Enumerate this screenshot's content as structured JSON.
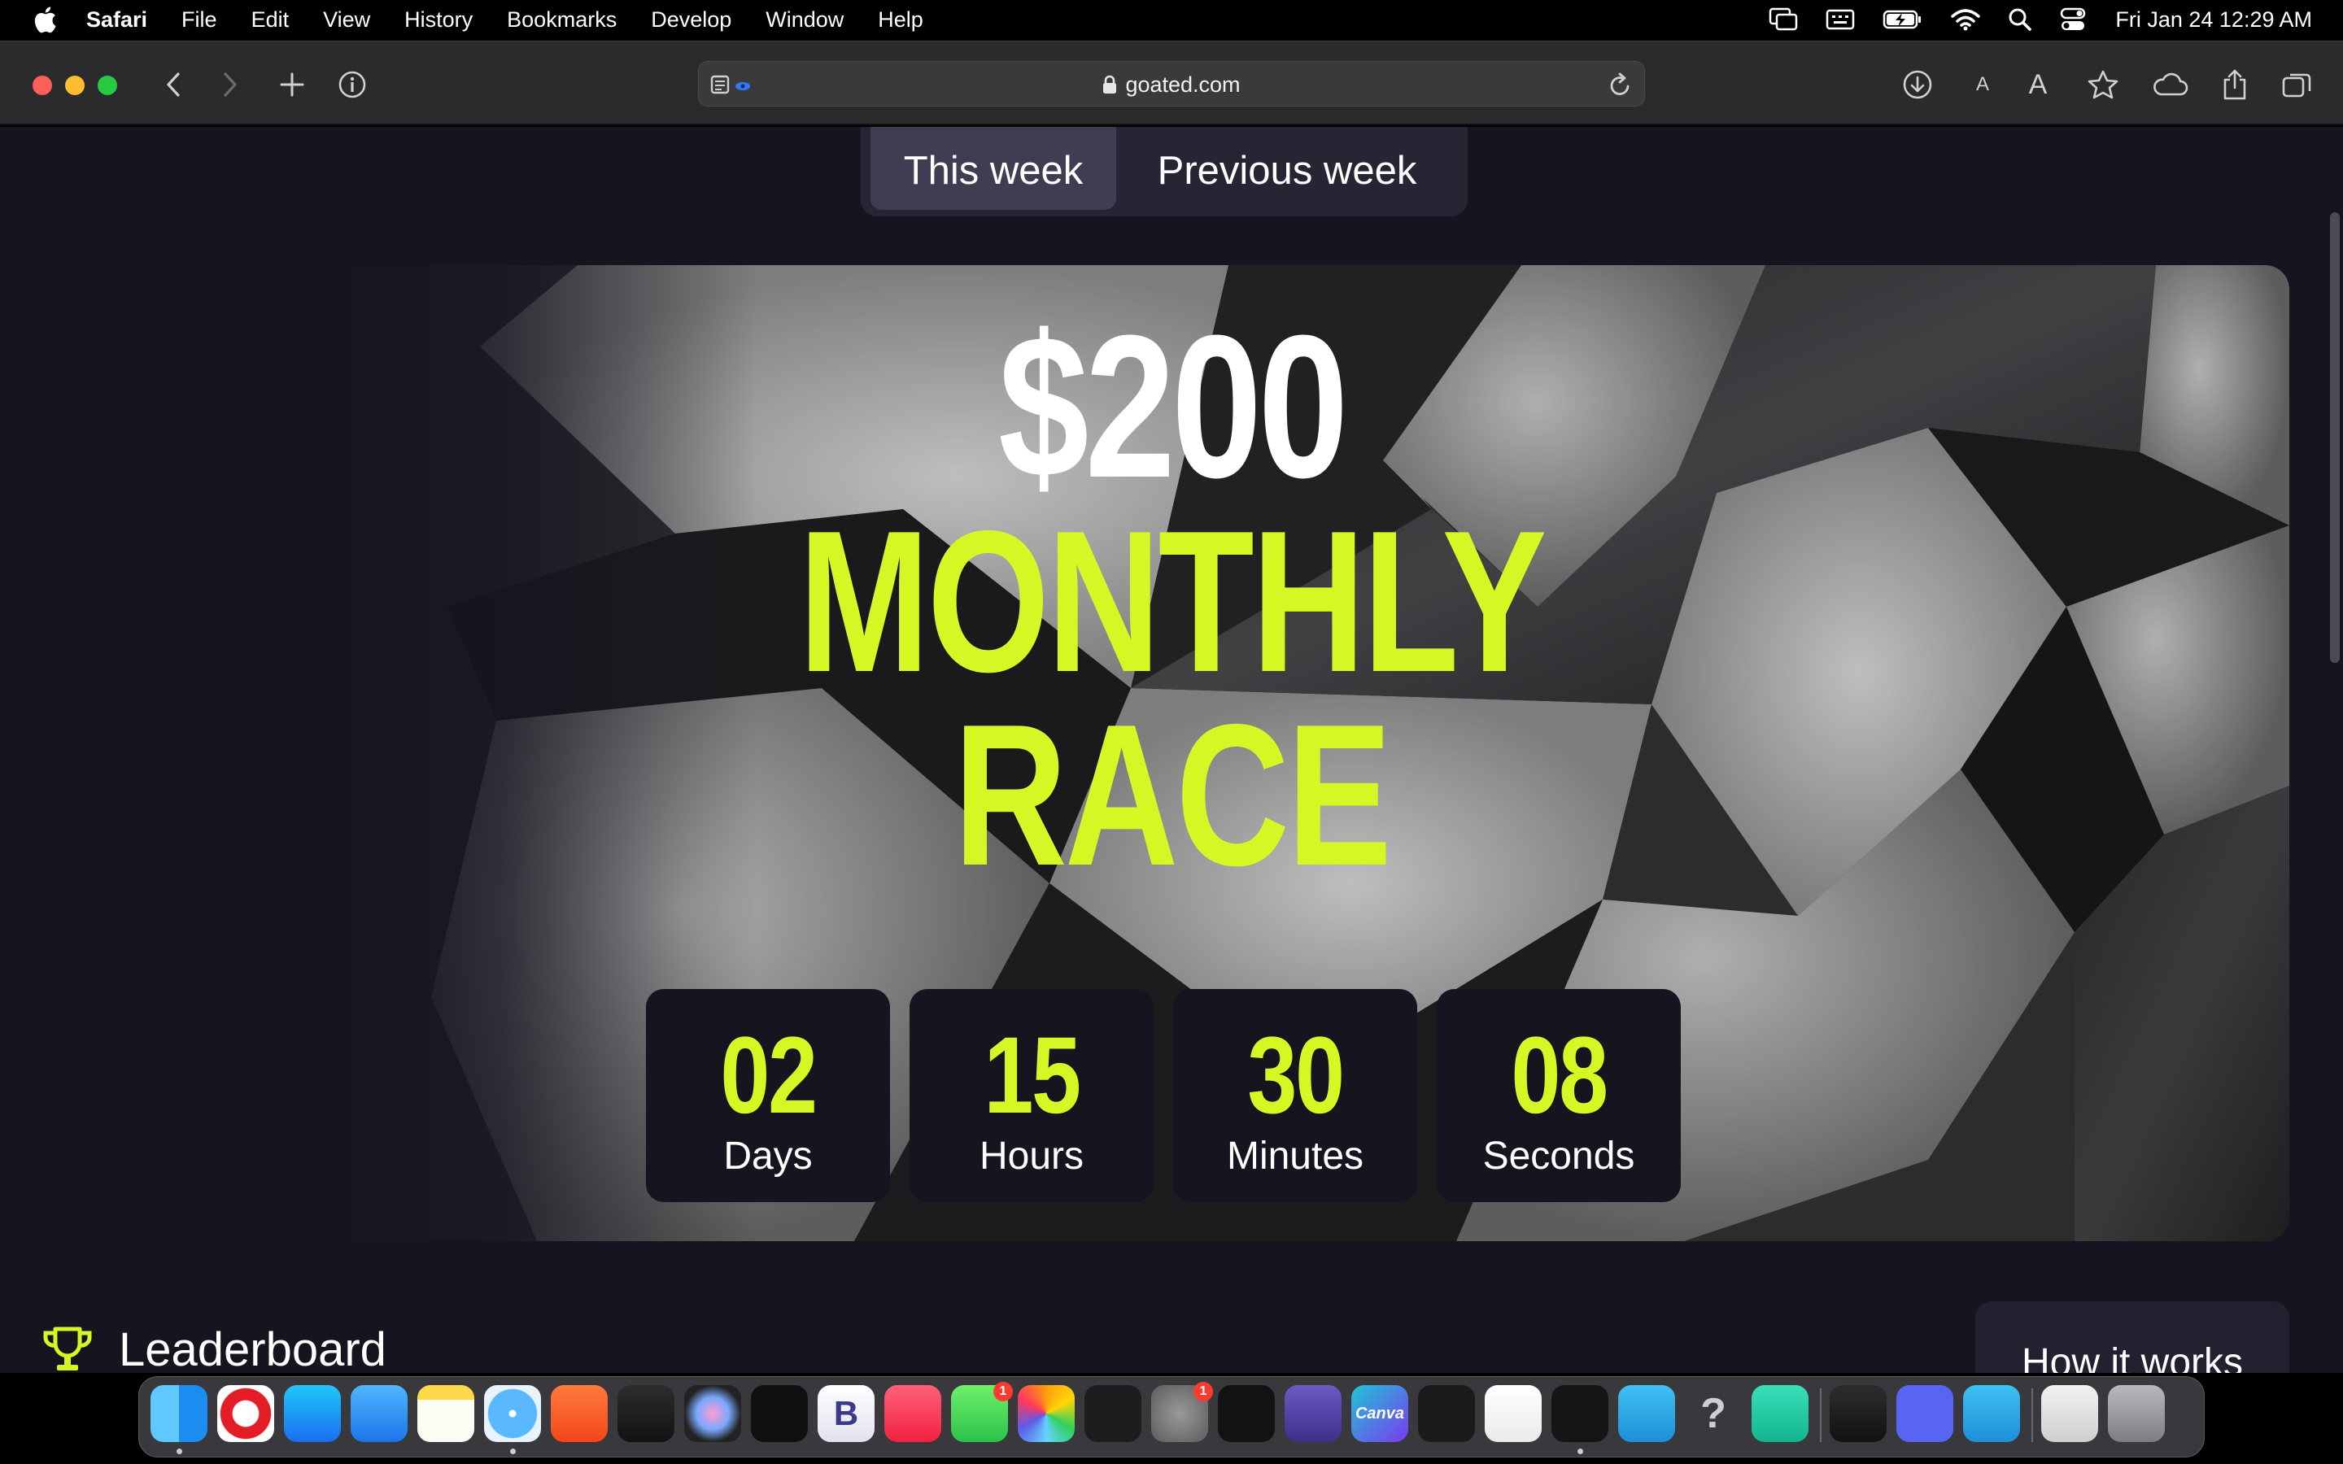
{
  "menubar": {
    "app_name": "Safari",
    "items": [
      "File",
      "Edit",
      "View",
      "History",
      "Bookmarks",
      "Develop",
      "Window",
      "Help"
    ],
    "clock": "Fri Jan 24  12:29 AM",
    "status_icons": [
      "screen-mirroring-icon",
      "keyboard-input-icon",
      "battery-charging-icon",
      "wifi-icon",
      "spotlight-search-icon",
      "control-center-icon"
    ]
  },
  "browser": {
    "url": "goated.com",
    "toolbar_icons": [
      "sidebar-icon",
      "back-icon",
      "forward-icon",
      "new-tab-icon",
      "info-icon",
      "reader-icon",
      "reload-icon",
      "downloads-icon",
      "text-smaller-icon",
      "text-larger-icon",
      "bookmark-star-icon",
      "icloud-icon",
      "share-icon",
      "tabs-overview-icon"
    ],
    "text_small": "A",
    "text_large": "A"
  },
  "page": {
    "toggle": {
      "this_week": "This week",
      "previous_week": "Previous week",
      "selected": "This week"
    },
    "hero": {
      "prize": "$200",
      "title_line1": "MONTHLY",
      "title_line2": "RACE"
    },
    "countdown": [
      {
        "value": "02",
        "label": "Days"
      },
      {
        "value": "15",
        "label": "Hours"
      },
      {
        "value": "30",
        "label": "Minutes"
      },
      {
        "value": "08",
        "label": "Seconds"
      }
    ],
    "leaderboard_title": "Leaderboard",
    "how_it_works": "How it works"
  },
  "colors": {
    "accent": "#d7f725",
    "page_bg": "#15141f",
    "toggle_bg": "#262534",
    "toggle_active": "#3f3d52"
  },
  "dock": {
    "apps": [
      {
        "name": "finder-icon",
        "running": true
      },
      {
        "name": "opera-icon"
      },
      {
        "name": "app-store-icon"
      },
      {
        "name": "mail-icon"
      },
      {
        "name": "notes-icon"
      },
      {
        "name": "safari-icon",
        "running": true
      },
      {
        "name": "brave-icon"
      },
      {
        "name": "bitwarden-icon"
      },
      {
        "name": "dotted-sphere-icon"
      },
      {
        "name": "chatgpt-icon"
      },
      {
        "name": "b-app-icon",
        "text": "B"
      },
      {
        "name": "music-icon"
      },
      {
        "name": "messages-icon",
        "badge": "1"
      },
      {
        "name": "photos-icon"
      },
      {
        "name": "terminal-icon"
      },
      {
        "name": "system-settings-icon",
        "badge": "1"
      },
      {
        "name": "chatgpt-alt-icon"
      },
      {
        "name": "gameboy-emulator-icon"
      },
      {
        "name": "canva-icon",
        "text": "Canva"
      },
      {
        "name": "openai-icon"
      },
      {
        "name": "brackets-editor-icon"
      },
      {
        "name": "blocks-app-icon",
        "running": true
      },
      {
        "name": "telegram-icon"
      },
      {
        "name": "help-question-icon",
        "text": "?"
      },
      {
        "name": "robot-app-icon"
      },
      {
        "name": "activity-monitor-icon"
      },
      {
        "name": "discord-icon"
      },
      {
        "name": "telegram-alt-icon"
      },
      {
        "name": "document-stack-icon"
      },
      {
        "name": "trash-icon"
      }
    ]
  }
}
